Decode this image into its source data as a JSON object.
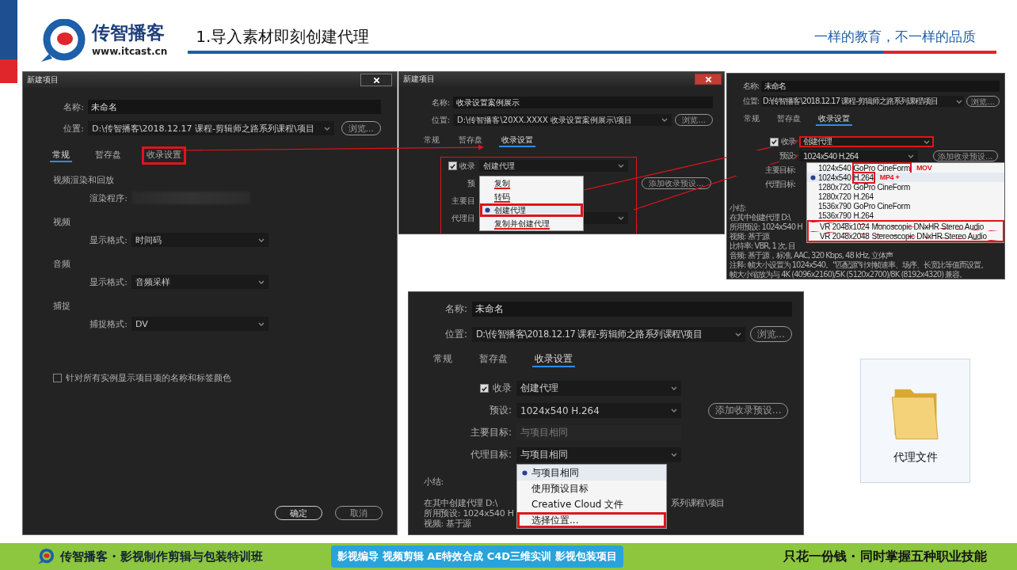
{
  "header": {
    "brand": "传智播客",
    "url": "www.itcast.cn",
    "title": "1.导入素材即刻创建代理",
    "slogan": "一样的教育，不一样的品质"
  },
  "dialogs": [
    {
      "kind": "general",
      "title": "新建项目",
      "name_label": "名称:",
      "name_value": "未命名",
      "location_label": "位置:",
      "location_value": "D:\\传智播客\\2018.12.17 课程-剪辑师之路系列课程\\项目",
      "browse": "浏览...",
      "tabs": [
        {
          "label": "常规",
          "selected": true,
          "highlighted": false
        },
        {
          "label": "暂存盘",
          "selected": false,
          "highlighted": false
        },
        {
          "label": "收录设置",
          "selected": false,
          "highlighted": true
        }
      ],
      "sections": [
        {
          "heading": "视频渲染和回放",
          "fields": [
            {
              "label": "渲染程序:",
              "kind": "blurred"
            }
          ]
        },
        {
          "heading": "视频",
          "fields": [
            {
              "label": "显示格式:",
              "kind": "dropdown",
              "value": "时间码"
            }
          ]
        },
        {
          "heading": "音频",
          "fields": [
            {
              "label": "显示格式:",
              "kind": "dropdown",
              "value": "音频采样"
            }
          ]
        },
        {
          "heading": "捕捉",
          "fields": [
            {
              "label": "捕捉格式:",
              "kind": "dropdown",
              "value": "DV"
            }
          ]
        }
      ],
      "option": {
        "label": "针对所有实例显示项目项的名称和标签颜色",
        "checked": false
      },
      "buttons": [
        {
          "label": "确定",
          "default": true
        },
        {
          "label": "取消",
          "default": false
        }
      ]
    },
    {
      "kind": "ingest",
      "title": "新建项目",
      "name_label": "名称:",
      "name_value": "收录设置案例展示",
      "location_label": "位置:",
      "location_value": "D:\\传智播客\\20XX.XXXX 收录设置案例展示\\项目",
      "browse": "浏览...",
      "tabs": [
        {
          "label": "常规",
          "selected": false,
          "highlighted": false
        },
        {
          "label": "暂存盘",
          "selected": false,
          "highlighted": false
        },
        {
          "label": "收录设置",
          "selected": true,
          "highlighted": false
        }
      ],
      "form_boxed": true,
      "ingest": {
        "checked": true,
        "label": "收录",
        "value": "创建代理",
        "highlighted": false
      },
      "rows": [
        {
          "label": "预",
          "kind": "none",
          "button": "添加收录预设..."
        },
        {
          "label": "主要目",
          "kind": "none"
        },
        {
          "label": "代理目",
          "kind": "dropdown"
        }
      ],
      "menu": {
        "items": [
          {
            "label": "复制",
            "selected": false,
            "struck": true,
            "highlighted": false
          },
          {
            "label": "转码",
            "selected": false,
            "struck": true,
            "highlighted": false
          },
          {
            "label": "创建代理",
            "selected": true,
            "struck": false,
            "highlighted": true
          },
          {
            "label": "复制并创建代理",
            "selected": false,
            "struck": true,
            "highlighted": false
          }
        ]
      }
    },
    {
      "kind": "ingest",
      "name_label": "名称:",
      "name_value": "未命名",
      "location_label": "位置:",
      "location_value": "D:\\传智播客\\2018.12.17 课程-剪辑师之路系列课程\\项目",
      "browse": "浏览...",
      "tabs": [
        {
          "label": "常规",
          "selected": false,
          "highlighted": false
        },
        {
          "label": "暂存盘",
          "selected": false,
          "highlighted": false
        },
        {
          "label": "收录设置",
          "selected": true,
          "highlighted": false
        }
      ],
      "ingest": {
        "checked": true,
        "label": "收录",
        "value": "创建代理",
        "highlighted": true
      },
      "rows": [
        {
          "label": "预设:",
          "kind": "dropdown",
          "value": "1024x540 H.264",
          "button": "添加收录预设..."
        },
        {
          "label": "主要目标:",
          "kind": "none"
        },
        {
          "label": "代理目标:",
          "kind": "none"
        }
      ],
      "menu": {
        "items": [
          {
            "label": "1024x540",
            "tag": "GoPro CineForm",
            "tag_boxed": true,
            "note": "MOV",
            "selected": false,
            "crossed": false
          },
          {
            "label": "1024x540",
            "tag": "H.264",
            "tag_boxed": true,
            "note": "MP4 +",
            "selected": true,
            "crossed": false
          },
          {
            "label": "1280x720",
            "tag": "GoPro CineForm",
            "tag_boxed": false,
            "selected": false,
            "crossed": false
          },
          {
            "label": "1280x720",
            "tag": "H.264",
            "tag_boxed": false,
            "selected": false,
            "crossed": false
          },
          {
            "label": "1536x790",
            "tag": "GoPro CineForm",
            "tag_boxed": false,
            "selected": false,
            "crossed": false
          },
          {
            "label": "1536x790",
            "tag": "H.264",
            "tag_boxed": false,
            "selected": false,
            "crossed": false
          },
          {
            "label": "VR 2048x1024",
            "tag": "Monoscopic DNxHR Stereo Audio",
            "tag_boxed": false,
            "selected": false,
            "crossed": true
          },
          {
            "label": "VR 2048x2048",
            "tag": "Stereoscopic DNxHR Stereo Audio",
            "tag_boxed": false,
            "selected": false,
            "crossed": true
          }
        ]
      },
      "summary": {
        "heading": "小结:",
        "lines": [
          {
            "text": "在其中创建代理 D:\\"
          },
          {
            "text": "所用预设: 1024x540 H"
          },
          {
            "text": "视频: 基于源"
          },
          {
            "text": "比特率: VBR, 1 次, 目"
          },
          {
            "text": "音频: 基于源，标准, AAC, 320 Kbps, 48 kHz, 立体声"
          },
          {
            "text": "注释: 帧大小设置为 1024x540。\"匹配源\"针对帧速率、场序、长宽比等值而设置。"
          },
          {
            "text": "帧大小缩放为与 4K (4096x2160)/5K (5120x2700)/8K (8192x4320) 兼容。"
          }
        ]
      }
    },
    {
      "kind": "ingest",
      "name_label": "名称:",
      "name_value": "未命名",
      "location_label": "位置:",
      "location_value": "D:\\传智播客\\2018.12.17 课程-剪辑师之路系列课程\\项目",
      "browse": "浏览...",
      "tabs": [
        {
          "label": "常规",
          "selected": false,
          "highlighted": false
        },
        {
          "label": "暂存盘",
          "selected": false,
          "highlighted": false
        },
        {
          "label": "收录设置",
          "selected": true,
          "highlighted": false
        }
      ],
      "ingest": {
        "checked": true,
        "label": "收录",
        "value": "创建代理",
        "highlighted": false
      },
      "rows": [
        {
          "label": "预设:",
          "kind": "dropdown",
          "value": "1024x540 H.264",
          "button": "添加收录预设..."
        },
        {
          "label": "主要目标:",
          "kind": "disabled",
          "value": "与项目相同"
        },
        {
          "label": "代理目标:",
          "kind": "dropdown",
          "value": "与项目相同"
        }
      ],
      "menu": {
        "items": [
          {
            "label": "与项目相同",
            "selected": true,
            "highlighted": false
          },
          {
            "label": "使用预设目标",
            "selected": false,
            "highlighted": false
          },
          {
            "label": "Creative Cloud 文件",
            "selected": false,
            "highlighted": false
          },
          {
            "label": "选择位置...",
            "selected": false,
            "highlighted": true
          }
        ]
      },
      "summary": {
        "heading": "小结:",
        "lines": [
          {
            "text": "在其中创建代理 D:\\",
            "text_after": "系列课程\\项目"
          },
          {
            "text": "所用预设: 1024x540 H"
          },
          {
            "text": "视频: 基于源"
          }
        ]
      }
    }
  ],
  "folder": {
    "label": "代理文件"
  },
  "footer": {
    "brand": "传智播客 · 影视制作剪辑与包装特训班",
    "courses": "影视编导 视频剪辑 AE特效合成 C4D三维实训 影视包装项目",
    "tagline": "只花一份钱 · 同时掌握五种职业技能"
  }
}
